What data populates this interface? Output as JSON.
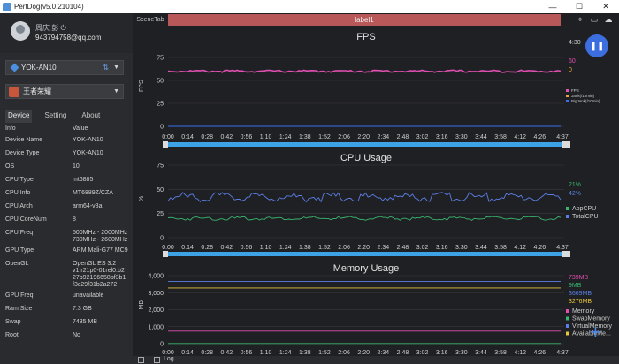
{
  "window": {
    "title": "PerfDog(v5.0.210104)",
    "minimize": "—",
    "maximize": "☐",
    "close": "✕"
  },
  "user": {
    "name": "周庆 彭 ⏻",
    "id": "943794758@qq.com"
  },
  "device_select": {
    "label": "YOK-AN10"
  },
  "app_select": {
    "label": "王者荣耀"
  },
  "tabs": [
    "Device",
    "Setting",
    "About"
  ],
  "info": {
    "header": {
      "k": "Info",
      "v": "Value"
    },
    "rows": [
      {
        "k": "Device Name",
        "v": "YOK-AN10"
      },
      {
        "k": "Device Type",
        "v": "YOK-AN10"
      },
      {
        "k": "OS",
        "v": "10"
      },
      {
        "k": "CPU Type",
        "v": "mt6885"
      },
      {
        "k": "CPU Info",
        "v": "MT6889Z/CZA"
      },
      {
        "k": "CPU Arch",
        "v": "arm64-v8a"
      },
      {
        "k": "CPU CoreNum",
        "v": "8"
      },
      {
        "k": "CPU Freq",
        "v": "500MHz - 2000MHz\n730MHz - 2600MHz"
      },
      {
        "k": "GPU Type",
        "v": "ARM Mali-G77 MC9"
      },
      {
        "k": "OpenGL",
        "v": "OpenGL ES 3.2\nv1.r21p0-01rel0.b2\n27b92196658bf3b1\nf3c29f31b2a272"
      },
      {
        "k": "GPU Freq",
        "v": "unavailable"
      },
      {
        "k": "Ram Size",
        "v": "7.3 GB"
      },
      {
        "k": "Swap",
        "v": "7435 MB"
      },
      {
        "k": "Root",
        "v": "No"
      }
    ]
  },
  "main": {
    "scene_tab": "SceneTab",
    "label": "label1",
    "time_readout": "4:30",
    "log_label": "Log"
  },
  "colors": {
    "fps": "#e04fb2",
    "jank": "#e9a43c",
    "stutter": "#3b6ff0",
    "app_cpu": "#3ab56f",
    "total_cpu": "#5b7fe6",
    "memory": "#e04fb2",
    "swap": "#3ab56f",
    "virtual": "#5b7fe6",
    "available": "#e6c43a",
    "slider": "#3ea3e6"
  },
  "chart_data": [
    {
      "type": "line",
      "title": "FPS",
      "ylabel": "FPS",
      "ylim": [
        0,
        75
      ],
      "yticks": [
        "0",
        "25",
        "50",
        "75"
      ],
      "xticks": [
        "0:00",
        "0:14",
        "0:28",
        "0:42",
        "0:56",
        "1:10",
        "1:24",
        "1:38",
        "1:52",
        "2:06",
        "2:20",
        "2:34",
        "2:48",
        "3:02",
        "3:16",
        "3:30",
        "3:44",
        "3:58",
        "4:12",
        "4:26"
      ],
      "x_end": "4:37",
      "series": [
        {
          "name": "FPS",
          "value_label": "60",
          "mean": 60
        },
        {
          "name": "Jank(/10min)",
          "value_label": "0",
          "mean": 0
        },
        {
          "name": "BigJank(/10min)",
          "value_label": "",
          "mean": 0
        }
      ]
    },
    {
      "type": "line",
      "title": "CPU Usage",
      "ylabel": "%",
      "ylim": [
        0,
        75
      ],
      "yticks": [
        "0",
        "25",
        "50",
        "75"
      ],
      "xticks": [
        "0:00",
        "0:14",
        "0:28",
        "0:42",
        "0:56",
        "1:10",
        "1:24",
        "1:38",
        "1:52",
        "2:06",
        "2:20",
        "2:34",
        "2:48",
        "3:02",
        "3:16",
        "3:30",
        "3:44",
        "3:58",
        "4:12",
        "4:26"
      ],
      "x_end": "4:37",
      "series": [
        {
          "name": "AppCPU",
          "value_label": "21%",
          "mean": 20
        },
        {
          "name": "TotalCPU",
          "value_label": "42%",
          "mean": 42
        }
      ]
    },
    {
      "type": "line",
      "title": "Memory Usage",
      "ylabel": "MB",
      "ylim": [
        0,
        4000
      ],
      "yticks": [
        "0",
        "1,000",
        "2,000",
        "3,000",
        "4,000"
      ],
      "xticks": [
        "0:00",
        "0:14",
        "0:28",
        "0:42",
        "0:56",
        "1:10",
        "1:24",
        "1:38",
        "1:52",
        "2:06",
        "2:20",
        "2:34",
        "2:48",
        "3:02",
        "3:16",
        "3:30",
        "3:44",
        "3:58",
        "4:12",
        "4:26"
      ],
      "x_end": "4:37",
      "series": [
        {
          "name": "Memory",
          "value_label": "739MB",
          "mean": 739
        },
        {
          "name": "SwapMemory",
          "value_label": "9MB",
          "mean": 9
        },
        {
          "name": "VirtualMemory",
          "value_label": "3669MB",
          "mean": 3669
        },
        {
          "name": "AvailableMe...",
          "value_label": "3276MB",
          "mean": 3276
        }
      ]
    }
  ]
}
